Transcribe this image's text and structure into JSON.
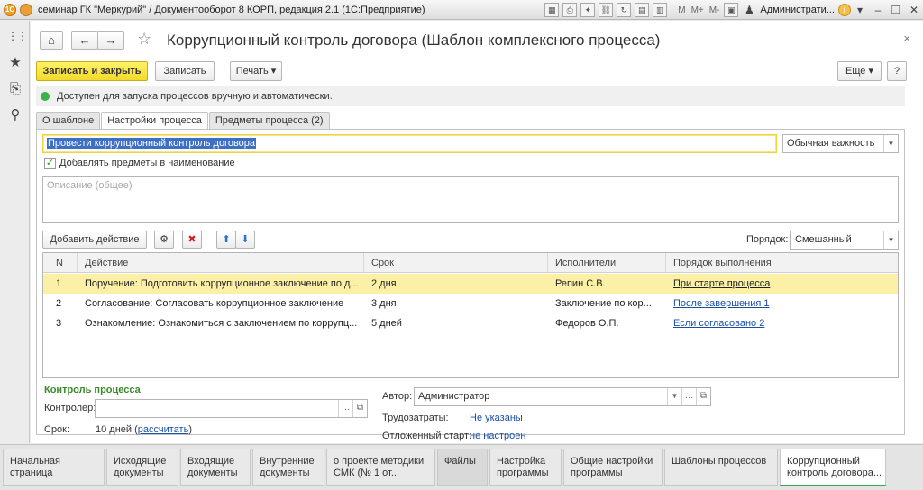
{
  "window": {
    "title": "семинар ГК \"Меркурий\" / Документооборот 8 КОРП, редакция 2.1  (1С:Предприятие)",
    "toolbar_text_m": "M",
    "toolbar_text_mplus": "M+",
    "toolbar_text_mminus": "M-",
    "user": "Администрати...",
    "info_icon": "i"
  },
  "sidebar": {
    "items": [
      {
        "icon": "apps-grid-icon",
        "glyph": "⋮⋮"
      },
      {
        "icon": "star-icon",
        "glyph": "★"
      },
      {
        "icon": "history-icon",
        "glyph": "⎘"
      },
      {
        "icon": "search-icon",
        "glyph": "⚲"
      }
    ]
  },
  "form": {
    "title": "Коррупционный контроль договора (Шаблон комплексного процесса)",
    "save_close_label": "Записать и закрыть",
    "save_label": "Записать",
    "print_label": "Печать",
    "more_label": "Еще",
    "help_label": "?",
    "status_text": "Доступен для запуска процессов вручную и автоматически.",
    "status_color": "#3cb34a"
  },
  "tabs": [
    {
      "label": "О шаблоне",
      "active": false
    },
    {
      "label": "Настройки процесса",
      "active": true
    },
    {
      "label": "Предметы процесса (2)",
      "active": false
    }
  ],
  "settings": {
    "name_value": "Провести коррупционный контроль договора",
    "importance_value": "Обычная важность",
    "add_subjects_label": "Добавлять предметы в наименование",
    "add_subjects_checked": true,
    "description_placeholder": "Описание (общее)",
    "add_action_label": "Добавить действие",
    "order_label": "Порядок:",
    "order_value": "Смешанный"
  },
  "table": {
    "columns": [
      "N",
      "Действие",
      "Срок",
      "Исполнители",
      "Порядок выполнения"
    ],
    "rows": [
      {
        "n": "1",
        "action": "Поручение: Подготовить коррупционное заключение по д...",
        "term": "2 дня",
        "performers": "Репин С.В.",
        "order": "При старте процесса",
        "selected": true
      },
      {
        "n": "2",
        "action": "Согласование: Согласовать коррупционное заключение",
        "term": "3 дня",
        "performers": "Заключение по кор...",
        "order": "После завершения 1",
        "selected": false
      },
      {
        "n": "3",
        "action": "Ознакомление: Ознакомиться с заключением по коррупц...",
        "term": "5 дней",
        "performers": "Федоров О.П.",
        "order": "Если согласовано 2",
        "selected": false
      }
    ]
  },
  "control": {
    "section_title": "Контроль процесса",
    "controller_label": "Контролер:",
    "controller_value": "",
    "term_label": "Срок:",
    "term_value": "10 дней (",
    "term_link": "рассчитать",
    "term_close": ")",
    "author_label": "Автор:",
    "author_value": "Администратор",
    "labor_label": "Трудозатраты:",
    "labor_value": "Не указаны",
    "delayed_label": "Отложенный старт:",
    "delayed_value": "не настроен"
  },
  "bottom_tabs": [
    {
      "label": "Начальная страница",
      "state": "normal"
    },
    {
      "label": "Исходящие документы",
      "state": "normal"
    },
    {
      "label": "Входящие документы",
      "state": "normal"
    },
    {
      "label": "Внутренние документы",
      "state": "normal"
    },
    {
      "label": "о проекте методики СМК (№ 1 от...",
      "state": "normal"
    },
    {
      "label": "Файлы",
      "state": "dim"
    },
    {
      "label": "Настройка программы",
      "state": "normal"
    },
    {
      "label": "Общие настройки программы",
      "state": "normal"
    },
    {
      "label": "Шаблоны процессов",
      "state": "normal"
    },
    {
      "label": "Коррупционный контроль договора...",
      "state": "active"
    }
  ]
}
